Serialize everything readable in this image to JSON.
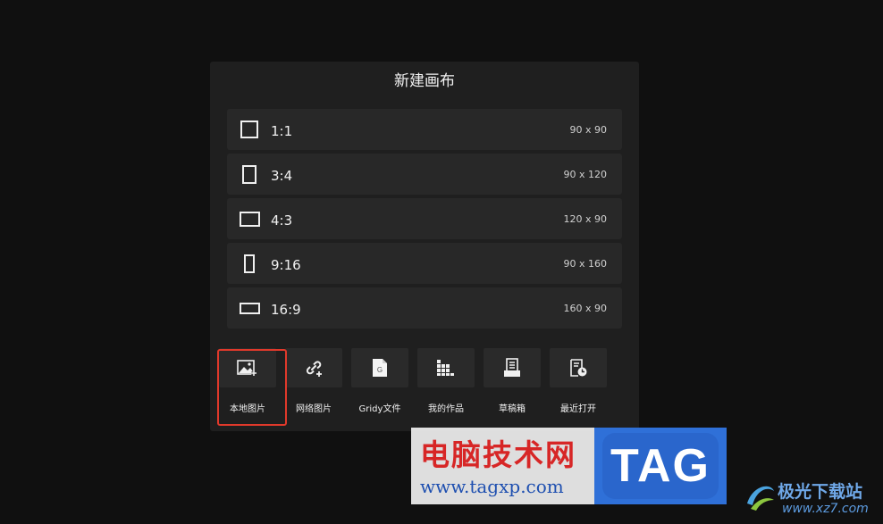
{
  "dialog": {
    "title": "新建画布",
    "ratios": [
      {
        "label": "1:1",
        "size": "90 x 90",
        "shape": [
          20,
          20
        ]
      },
      {
        "label": "3:4",
        "size": "90 x 120",
        "shape": [
          16,
          21
        ]
      },
      {
        "label": "4:3",
        "size": "120 x 90",
        "shape": [
          23,
          17
        ]
      },
      {
        "label": "9:16",
        "size": "90 x 160",
        "shape": [
          12,
          21
        ]
      },
      {
        "label": "16:9",
        "size": "160 x 90",
        "shape": [
          23,
          13
        ]
      }
    ],
    "sources": [
      {
        "label": "本地图片",
        "icon": "image-add-icon",
        "highlighted": true
      },
      {
        "label": "网络图片",
        "icon": "link-add-icon"
      },
      {
        "label": "Gridy文件",
        "icon": "gridy-file-icon"
      },
      {
        "label": "我的作品",
        "icon": "grid-works-icon"
      },
      {
        "label": "草稿箱",
        "icon": "draft-box-icon"
      },
      {
        "label": "最近打开",
        "icon": "recent-file-icon"
      }
    ]
  },
  "watermark": {
    "title": "电脑技术网",
    "url": "www.tagxp.com",
    "tag": "TAG",
    "site_name": "极光下载站",
    "site_url": "www.xz7.com"
  },
  "colors": {
    "background": "#101010",
    "dialog": "#1f1f1f",
    "row": "#282828",
    "highlight": "#e0392b"
  }
}
